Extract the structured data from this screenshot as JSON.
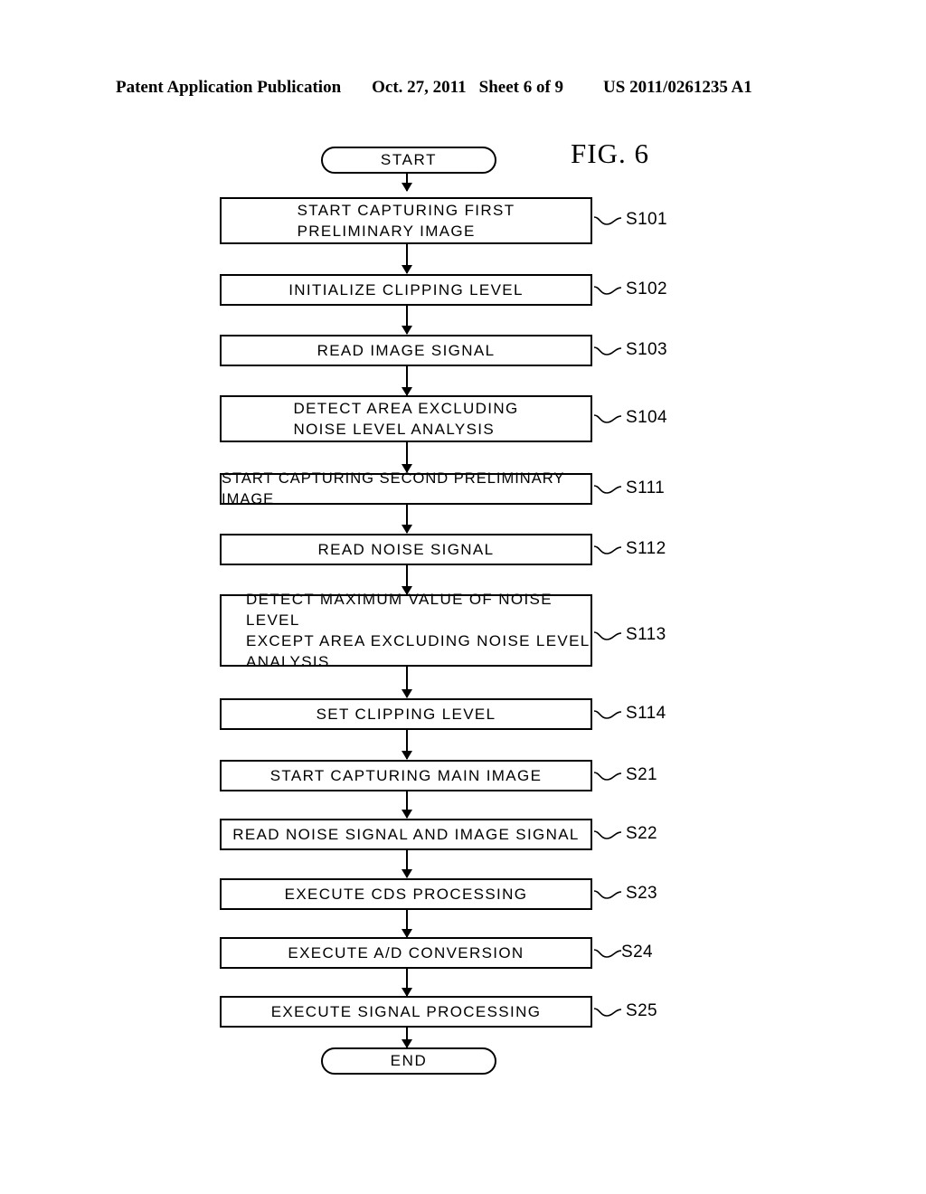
{
  "header": {
    "publication": "Patent Application Publication",
    "date": "Oct. 27, 2011",
    "sheet": "Sheet 6 of 9",
    "patent_number": "US 2011/0261235 A1"
  },
  "figure": {
    "label": "FIG. 6"
  },
  "flowchart": {
    "start_label": "START",
    "end_label": "END",
    "steps": [
      {
        "id": "S101",
        "text": "START CAPTURING FIRST\nPRELIMINARY IMAGE"
      },
      {
        "id": "S102",
        "text": "INITIALIZE CLIPPING LEVEL"
      },
      {
        "id": "S103",
        "text": "READ IMAGE SIGNAL"
      },
      {
        "id": "S104",
        "text": "DETECT AREA EXCLUDING\nNOISE LEVEL ANALYSIS"
      },
      {
        "id": "S111",
        "text": "START CAPTURING SECOND PRELIMINARY IMAGE"
      },
      {
        "id": "S112",
        "text": "READ NOISE SIGNAL"
      },
      {
        "id": "S113",
        "text": "DETECT MAXIMUM VALUE OF NOISE LEVEL\nEXCEPT AREA EXCLUDING NOISE LEVEL\nANALYSIS"
      },
      {
        "id": "S114",
        "text": "SET CLIPPING LEVEL"
      },
      {
        "id": "S21",
        "text": "START CAPTURING MAIN IMAGE"
      },
      {
        "id": "S22",
        "text": "READ NOISE SIGNAL AND IMAGE SIGNAL"
      },
      {
        "id": "S23",
        "text": "EXECUTE CDS PROCESSING"
      },
      {
        "id": "S24",
        "text": "EXECUTE A/D CONVERSION"
      },
      {
        "id": "S25",
        "text": "EXECUTE SIGNAL PROCESSING"
      }
    ]
  },
  "colors": {
    "ink": "#000000",
    "paper": "#ffffff"
  }
}
